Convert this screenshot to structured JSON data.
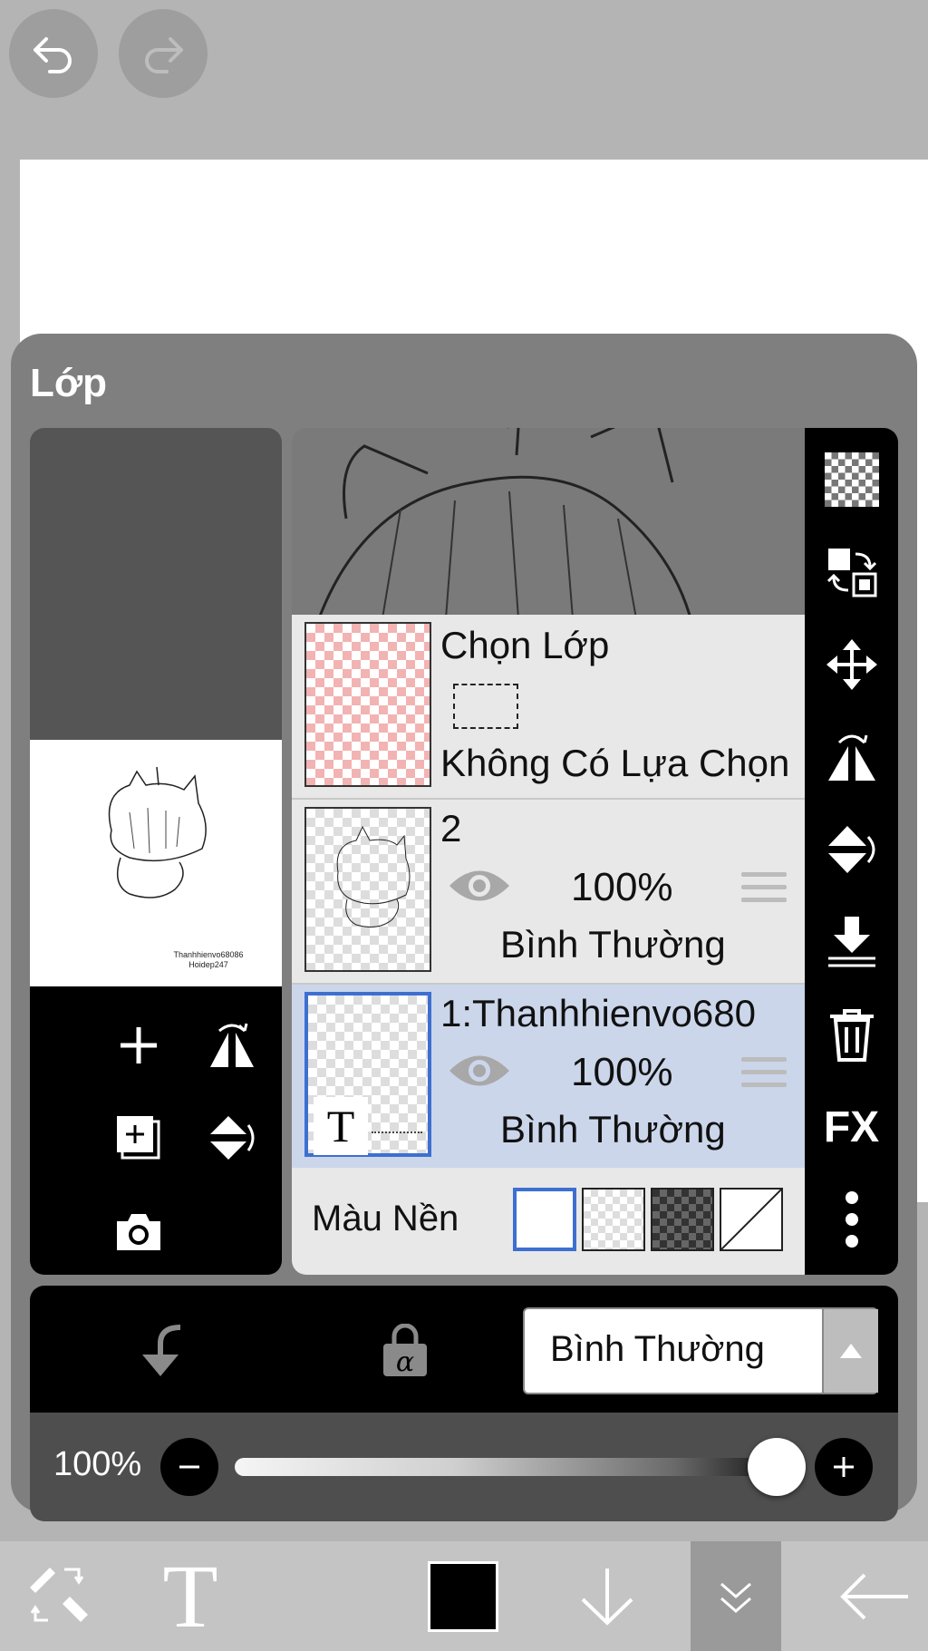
{
  "topbar": {
    "undo_icon": "undo-icon",
    "redo_icon": "redo-icon"
  },
  "panel": {
    "title": "Lớp"
  },
  "layers": [
    {
      "name": "Chọn Lớp",
      "subtitle": "Không Có Lựa Chọn",
      "type": "selection"
    },
    {
      "name": "2",
      "opacity": "100%",
      "mode": "Bình Thường",
      "visible": true
    },
    {
      "name": "1:Thanhhienvo680",
      "opacity": "100%",
      "mode": "Bình Thường",
      "visible": true,
      "selected": true
    }
  ],
  "background": {
    "label": "Màu Nền",
    "options": [
      "white",
      "checker-light",
      "checker-dark",
      "none"
    ],
    "selected": "white"
  },
  "blend": {
    "mode": "Bình Thường"
  },
  "opacity": {
    "label": "100%",
    "value": 1.0
  },
  "preview": {
    "watermark_line1": "Thanhhienvo68086",
    "watermark_line2": "Hoidep247"
  },
  "right_toolbar": [
    "checker-icon",
    "swap-icon",
    "move-icon",
    "flip-horizontal-icon",
    "flip-vertical-icon",
    "merge-down-icon",
    "trash-icon",
    "fx-icon",
    "more-icon"
  ],
  "right_toolbar_fx": "FX",
  "colors": {
    "accent": "#3d6fd1",
    "selected_row": "#cbd6eb",
    "panel": "#7f7f7f"
  },
  "bottom_toolbar": [
    "brush-eraser-icon",
    "text-icon",
    "color-swatch",
    "down-arrow-icon",
    "collapse-icon",
    "back-arrow-icon"
  ],
  "text_tool_glyph": "T",
  "thumb_text_glyph": "T"
}
